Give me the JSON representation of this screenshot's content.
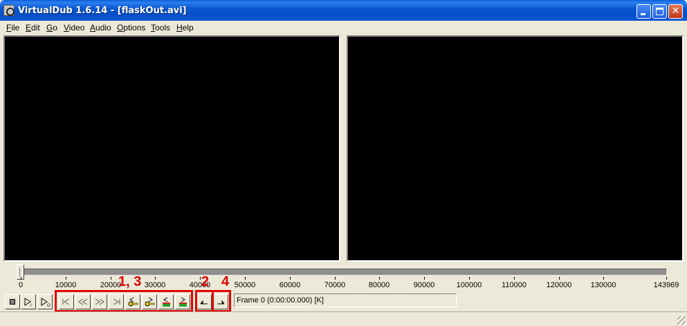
{
  "window": {
    "title": "VirtualDub 1.6.14 - [flaskOut.avi]",
    "icon": "virtualdub-gear-icon",
    "controls": [
      "minimize-icon",
      "maximize-icon",
      "close-icon"
    ],
    "close_glyph": "✕"
  },
  "menu": {
    "items": [
      "File",
      "Edit",
      "Go",
      "Video",
      "Audio",
      "Options",
      "Tools",
      "Help"
    ]
  },
  "timeline": {
    "position": 0,
    "max": 143969,
    "ticks": [
      "0",
      "10000",
      "20000",
      "30000",
      "40000",
      "50000",
      "60000",
      "70000",
      "80000",
      "90000",
      "100000",
      "110000",
      "120000",
      "130000",
      "143969"
    ]
  },
  "toolbar": {
    "buttons": [
      {
        "name": "stop-button",
        "icon": "stop-icon"
      },
      {
        "name": "play-input-button",
        "icon": "play-input-icon"
      },
      {
        "name": "play-output-button",
        "icon": "play-output-icon"
      },
      {
        "name": "go-to-start-button",
        "icon": "go-to-start-icon"
      },
      {
        "name": "step-back-button",
        "icon": "step-back-icon"
      },
      {
        "name": "step-forward-button",
        "icon": "step-forward-icon"
      },
      {
        "name": "go-to-end-button",
        "icon": "go-to-end-icon"
      },
      {
        "name": "previous-keyframe-button",
        "icon": "key-back-icon"
      },
      {
        "name": "next-keyframe-button",
        "icon": "key-forward-icon"
      },
      {
        "name": "previous-scene-button",
        "icon": "scene-back-icon"
      },
      {
        "name": "next-scene-button",
        "icon": "scene-forward-icon"
      },
      {
        "name": "mark-in-button",
        "icon": "mark-in-icon"
      },
      {
        "name": "mark-out-button",
        "icon": "mark-out-icon"
      }
    ]
  },
  "frame_status": "Frame 0 (0:00:00.000) [K]",
  "annotations": {
    "color": "#e00000",
    "labels": [
      "1, 3",
      "2",
      "4"
    ]
  }
}
